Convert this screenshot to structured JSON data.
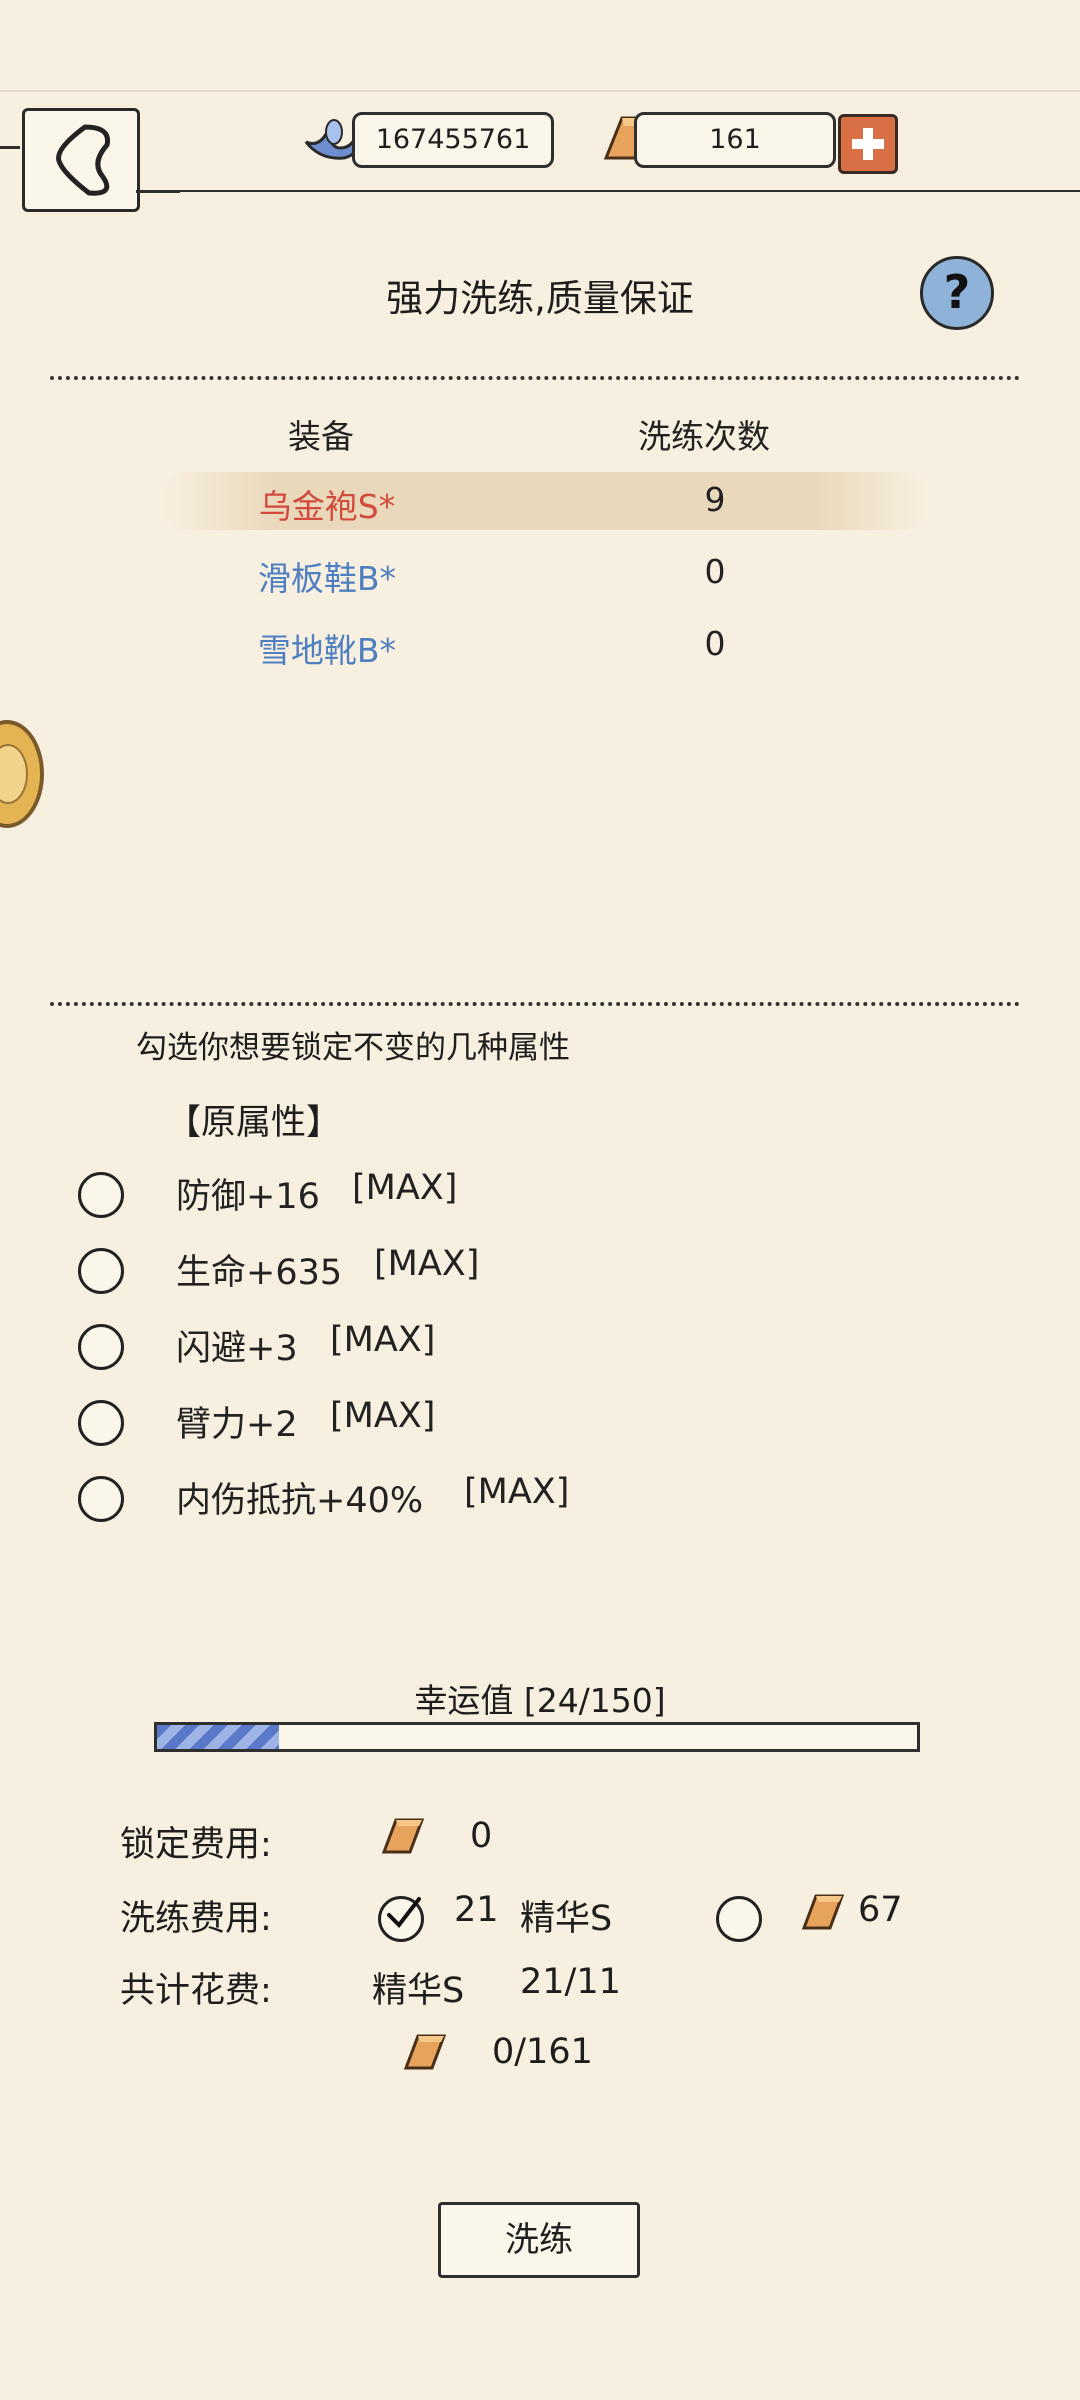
{
  "header": {
    "silver_amount": "167455761",
    "gold_amount": "161"
  },
  "title": "强力洗练,质量保证",
  "equipment": {
    "col_equipment": "装备",
    "col_refine_count": "洗练次数",
    "rows": [
      {
        "name": "乌金袍S*",
        "count": "9",
        "color": "#d24a3c"
      },
      {
        "name": "滑板鞋B*",
        "count": "0",
        "color": "#4f7fc0"
      },
      {
        "name": "雪地靴B*",
        "count": "0",
        "color": "#4f7fc0"
      }
    ]
  },
  "attributes": {
    "hint": "勾选你想要锁定不变的几种属性",
    "section_title": "【原属性】",
    "items": [
      {
        "name": "防御+16",
        "tag": "[MAX]"
      },
      {
        "name": "生命+635",
        "tag": "[MAX]"
      },
      {
        "name": "闪避+3",
        "tag": "[MAX]"
      },
      {
        "name": "臂力+2",
        "tag": "[MAX]"
      },
      {
        "name": "内伤抵抗+40%",
        "tag": "[MAX]"
      }
    ]
  },
  "luck": {
    "label": "幸运值  [24/150]",
    "current": 24,
    "max": 150
  },
  "costs": {
    "lock_label": "锁定费用:",
    "lock_value": "0",
    "refine_label": "洗练费用:",
    "refine_essence_amount": "21",
    "refine_essence_name": "精华S",
    "refine_gold_amount": "67",
    "total_label": "共计花费:",
    "total_essence_name": "精华S",
    "total_essence_value": "21/11",
    "total_gold_value": "0/161"
  },
  "action": {
    "refine_button": "洗练"
  },
  "colors": {
    "background": "#f7f0e0",
    "gold": "#e7a25b",
    "plus_button": "#d86f45",
    "help_button": "#8fb3d8"
  }
}
